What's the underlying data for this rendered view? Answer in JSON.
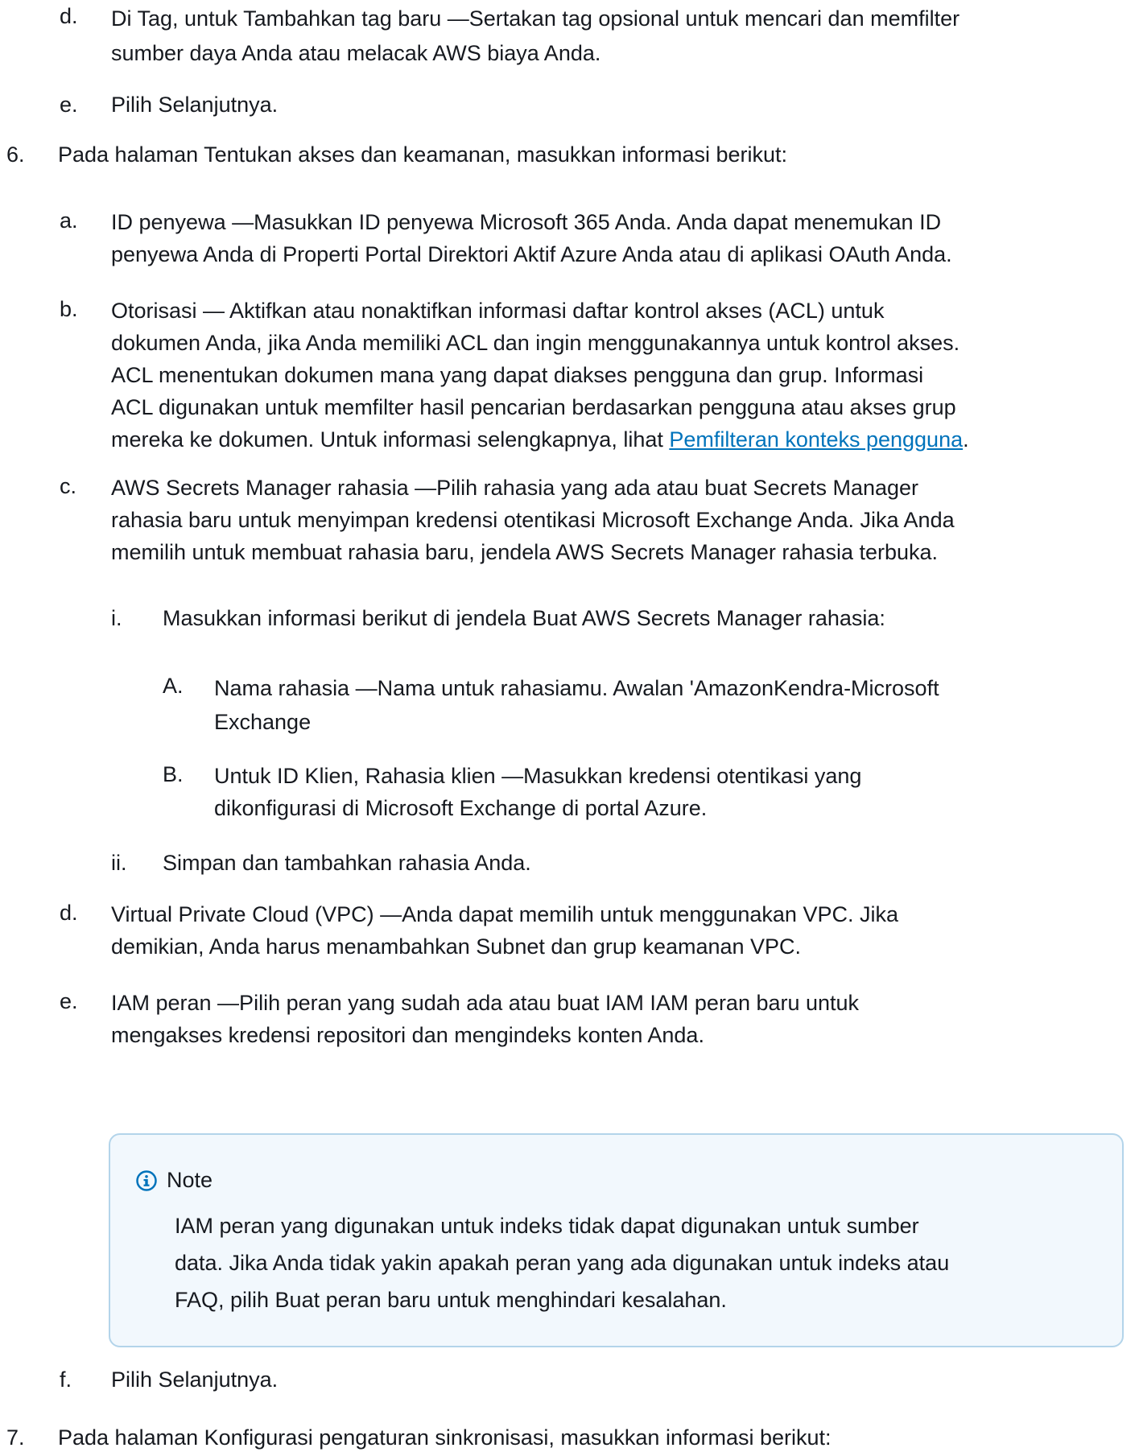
{
  "steps": {
    "d1": {
      "marker": "d.",
      "lines": [
        "Di Tag, untuk Tambahkan tag baru —Sertakan tag opsional untuk mencari dan memfilter",
        "sumber daya Anda atau melacak AWS biaya Anda."
      ]
    },
    "e1": {
      "marker": "e.",
      "text": "Pilih Selanjutnya."
    },
    "s6": {
      "marker": "6.",
      "text": "Pada halaman Tentukan akses dan keamanan, masukkan informasi berikut:"
    },
    "a6": {
      "marker": "a.",
      "lines": [
        "ID penyewa —Masukkan ID penyewa Microsoft 365 Anda. Anda dapat menemukan ID",
        "penyewa Anda di Properti Portal Direktori Aktif Azure Anda atau di aplikasi OAuth Anda."
      ]
    },
    "b6": {
      "marker": "b.",
      "lines": [
        "Otorisasi — Aktifkan atau nonaktifkan informasi daftar kontrol akses (ACL) untuk",
        "dokumen Anda, jika Anda memiliki ACL dan ingin menggunakannya untuk kontrol akses.",
        "ACL menentukan dokumen mana yang dapat diakses pengguna dan grup. Informasi",
        "ACL digunakan untuk memfilter hasil pencarian berdasarkan pengguna atau akses grup"
      ],
      "last_line_prefix": "mereka ke dokumen. Untuk informasi selengkapnya, lihat ",
      "link_text": "Pemfilteran konteks pengguna",
      "last_line_suffix": "."
    },
    "c6": {
      "marker": "c.",
      "lines": [
        "AWS Secrets Manager rahasia —Pilih rahasia yang ada atau buat Secrets Manager",
        "rahasia baru untuk menyimpan kredensi otentikasi Microsoft Exchange Anda. Jika Anda",
        "memilih untuk membuat rahasia baru, jendela AWS Secrets Manager rahasia terbuka."
      ]
    },
    "i6": {
      "marker": "i.",
      "text": "Masukkan informasi berikut di jendela Buat AWS Secrets Manager rahasia:"
    },
    "A6": {
      "marker": "A.",
      "lines": [
        "Nama rahasia —Nama untuk rahasiamu. Awalan 'AmazonKendra-Microsoft",
        "Exchange"
      ]
    },
    "B6": {
      "marker": "B.",
      "lines": [
        "Untuk ID Klien, Rahasia klien —Masukkan kredensi otentikasi yang",
        "dikonfigurasi di Microsoft Exchange di portal Azure."
      ]
    },
    "ii6": {
      "marker": "ii.",
      "text": "Simpan dan tambahkan rahasia Anda."
    },
    "d6": {
      "marker": "d.",
      "lines": [
        "Virtual Private Cloud (VPC) —Anda dapat memilih untuk menggunakan VPC. Jika",
        "demikian, Anda harus menambahkan Subnet dan grup keamanan VPC."
      ]
    },
    "e6": {
      "marker": "e.",
      "lines": [
        "IAM peran —Pilih peran yang sudah ada atau buat IAM IAM peran baru untuk",
        "mengakses kredensi repositori dan mengindeks konten Anda."
      ]
    },
    "f6": {
      "marker": "f.",
      "text": "Pilih Selanjutnya."
    },
    "s7": {
      "marker": "7.",
      "text": "Pada halaman Konfigurasi pengaturan sinkronisasi, masukkan informasi berikut:"
    }
  },
  "note": {
    "icon": "info-icon",
    "title": "Note",
    "lines": [
      "IAM peran yang digunakan untuk indeks tidak dapat digunakan untuk sumber",
      "data. Jika Anda tidak yakin apakah peran yang ada digunakan untuk indeks atau",
      "FAQ, pilih Buat peran baru untuk menghindari kesalahan."
    ]
  },
  "colors": {
    "text": "#16191f",
    "link": "#0073bb",
    "note_border": "#b3d4ea",
    "note_background": "#f2f8fd",
    "info_icon": "#0073bb"
  }
}
